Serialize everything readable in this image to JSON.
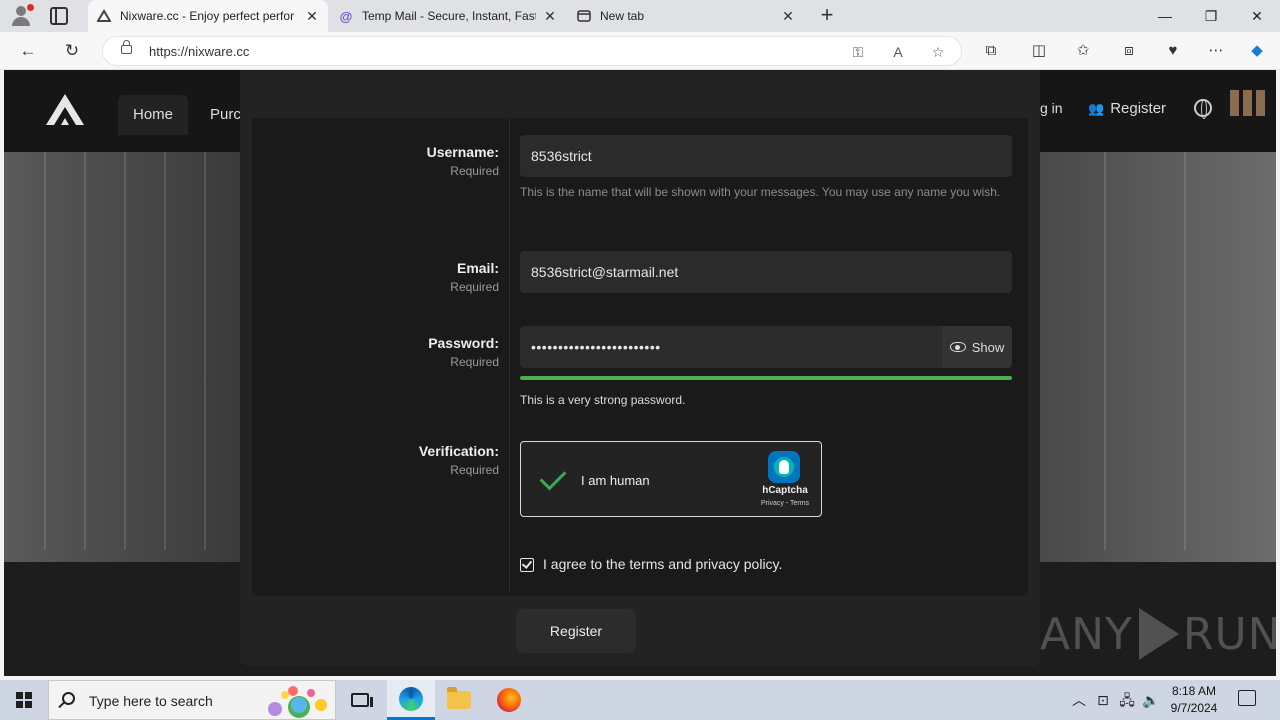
{
  "browser": {
    "tabs": [
      {
        "title": "Nixware.cc - Enjoy perfect perfor",
        "icon": "nixware-favicon"
      },
      {
        "title": "Temp Mail - Secure, Instant, Fast",
        "icon": "tempmail-favicon"
      },
      {
        "title": "New tab",
        "icon": "newtab-favicon"
      }
    ],
    "url": "https://nixware.cc"
  },
  "site": {
    "nav_home": "Home",
    "nav_purchase": "Purc",
    "nav_login": "g in",
    "nav_register": "Register"
  },
  "form": {
    "username": {
      "label": "Username:",
      "hint": "Required",
      "value": "8536strict",
      "note": "This is the name that will be shown with your messages. You may use any name you wish."
    },
    "email": {
      "label": "Email:",
      "hint": "Required",
      "value": "8536strict@starmail.net"
    },
    "password": {
      "label": "Password:",
      "hint": "Required",
      "value": "••••••••••••••••••••••••",
      "show_label": "Show",
      "strength_text": "This is a very strong password.",
      "strength_level": 1.0
    },
    "verification": {
      "label": "Verification:",
      "hint": "Required",
      "captcha_text": "I am human",
      "captcha_brand": "hCaptcha",
      "captcha_links": "Privacy - Terms"
    },
    "agree_text": "I agree to the terms and privacy policy.",
    "agree_checked": true,
    "submit_label": "Register"
  },
  "watermark": {
    "left": "ANY",
    "right": "RUN"
  },
  "taskbar": {
    "search_placeholder": "Type here to search",
    "time": "8:18 AM",
    "date": "9/7/2024"
  },
  "colors": {
    "strength_bar": "#4caf50",
    "captcha_check": "#3dab4c",
    "edge_accent": "#0078d4"
  }
}
